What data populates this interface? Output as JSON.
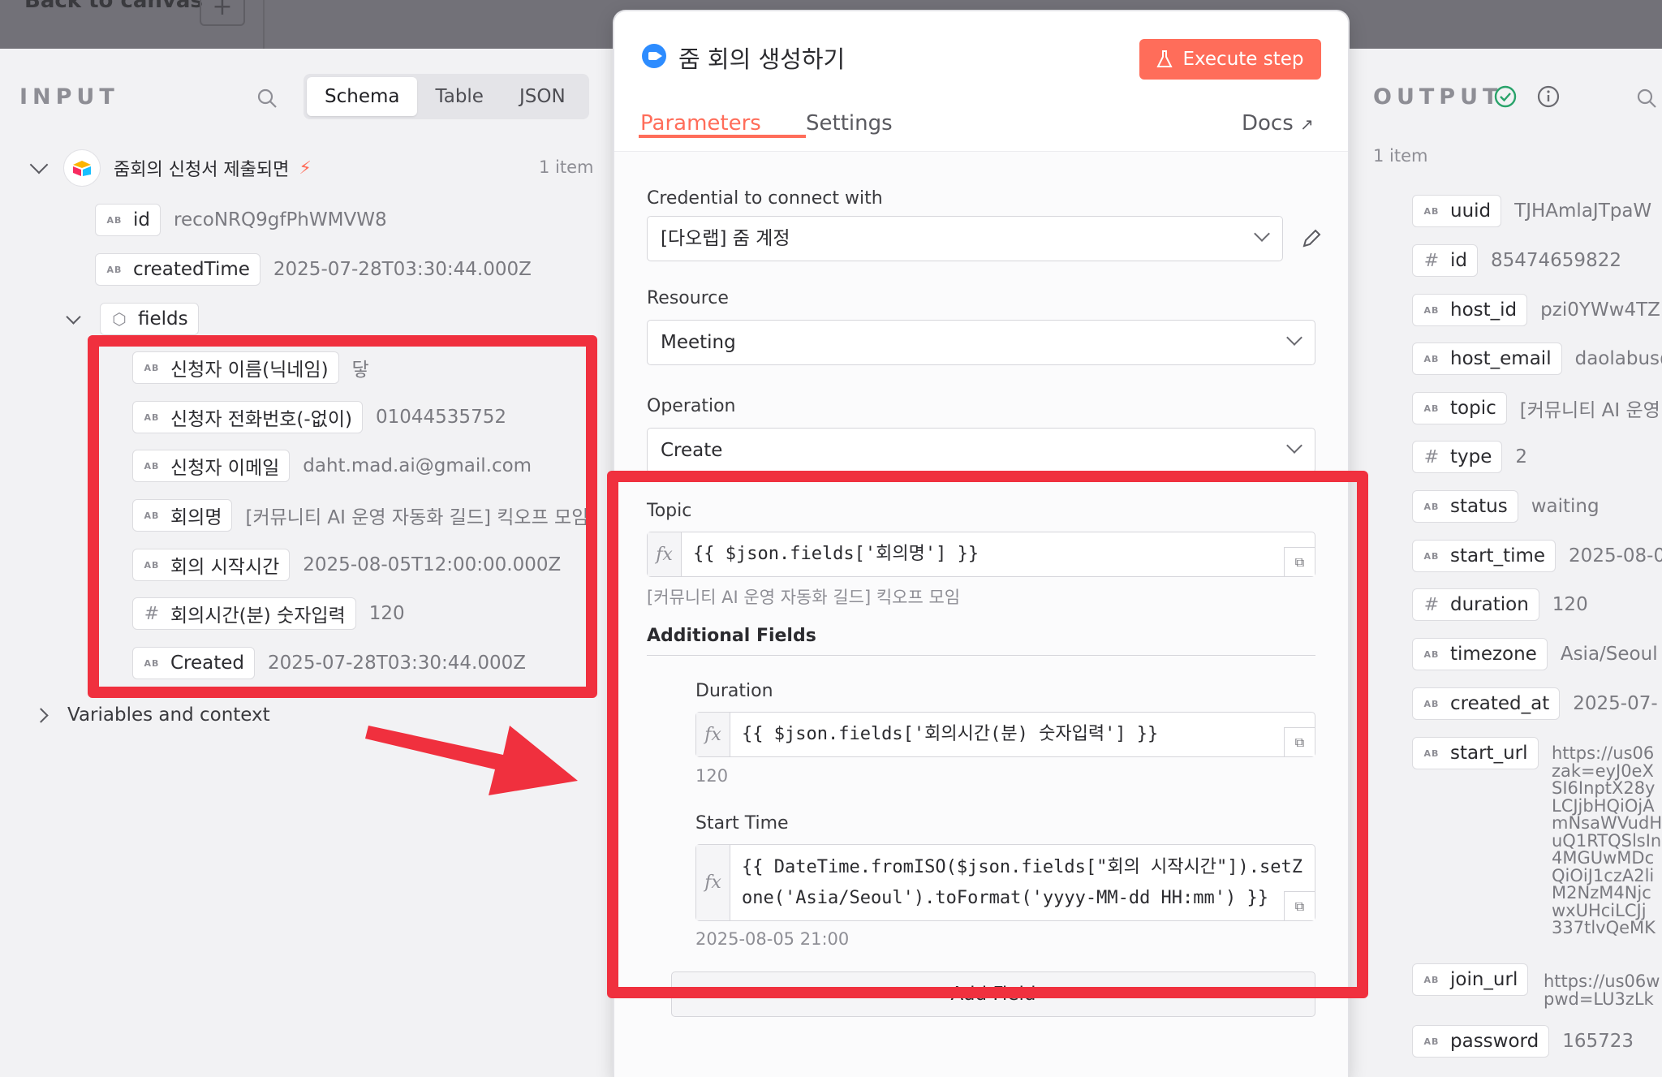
{
  "canvas": {
    "back_label": "Back to canvas",
    "plus": "+"
  },
  "input": {
    "title": "INPUT",
    "view_tabs": [
      "Schema",
      "Table",
      "JSON"
    ],
    "node_name": "줌회의 신청서 제출되면",
    "item_count": "1 item",
    "fields": [
      {
        "type": "AB",
        "key": "id",
        "value": "recoNRQ9gfPhWMVW8"
      },
      {
        "type": "AB",
        "key": "createdTime",
        "value": "2025-07-28T03:30:44.000Z"
      }
    ],
    "group_key": "fields",
    "sub_fields": [
      {
        "type": "AB",
        "key": "신청자 이름(닉네임)",
        "value": "닿"
      },
      {
        "type": "AB",
        "key": "신청자 전화번호(-없이)",
        "value": "01044535752"
      },
      {
        "type": "AB",
        "key": "신청자 이메일",
        "value": "daht.mad.ai@gmail.com"
      },
      {
        "type": "AB",
        "key": "회의명",
        "value": "[커뮤니티 AI 운영 자동화 길드] 킥오프 모임"
      },
      {
        "type": "AB",
        "key": "회의 시작시간",
        "value": "2025-08-05T12:00:00.000Z"
      },
      {
        "type": "#",
        "key": "회의시간(분) 숫자입력",
        "value": "120"
      },
      {
        "type": "AB",
        "key": "Created",
        "value": "2025-07-28T03:30:44.000Z"
      }
    ],
    "variables_label": "Variables and context"
  },
  "node": {
    "title": "줌 회의 생성하기",
    "execute_label": "Execute step",
    "tabs": {
      "parameters": "Parameters",
      "settings": "Settings",
      "docs": "Docs"
    },
    "credential_label": "Credential to connect with",
    "credential_value": "[다오랩] 줌 계정",
    "resource_label": "Resource",
    "resource_value": "Meeting",
    "operation_label": "Operation",
    "operation_value": "Create",
    "topic_label": "Topic",
    "topic_expr": "{{ $json.fields['회의명'] }}",
    "topic_result": "[커뮤니티 AI 운영 자동화 길드] 킥오프 모임",
    "additional_label": "Additional Fields",
    "duration_label": "Duration",
    "duration_expr": "{{ $json.fields['회의시간(분) 숫자입력'] }}",
    "duration_result": "120",
    "start_label": "Start Time",
    "start_expr_line1": "{{ DateTime.fromISO($json.fields[\"회의 시작시간\"]).setZ",
    "start_expr_line2": "one('Asia/Seoul').toFormat('yyyy-MM-dd HH:mm') }}",
    "start_result": "2025-08-05 21:00",
    "add_field_label": "Add Field"
  },
  "output": {
    "title": "OUTPUT",
    "item_count": "1 item",
    "fields": [
      {
        "type": "AB",
        "key": "uuid",
        "value": "TJHAmlaJTpaW"
      },
      {
        "type": "#",
        "key": "id",
        "value": "85474659822"
      },
      {
        "type": "AB",
        "key": "host_id",
        "value": "pzi0YWw4TZ"
      },
      {
        "type": "AB",
        "key": "host_email",
        "value": "daolabus@"
      },
      {
        "type": "AB",
        "key": "topic",
        "value": "[커뮤니티 AI 운영"
      },
      {
        "type": "#",
        "key": "type",
        "value": "2"
      },
      {
        "type": "AB",
        "key": "status",
        "value": "waiting"
      },
      {
        "type": "AB",
        "key": "start_time",
        "value": "2025-08-0"
      },
      {
        "type": "#",
        "key": "duration",
        "value": "120"
      },
      {
        "type": "AB",
        "key": "timezone",
        "value": "Asia/Seoul"
      },
      {
        "type": "AB",
        "key": "created_at",
        "value": "2025-07-"
      }
    ],
    "start_url_key": "start_url",
    "start_url_lines": [
      "https://us06",
      "zak=eyJ0eX",
      "SI6InptX28y",
      "LCJjbHQiOjA",
      "mNsaWVudH",
      "uQ1RTQSlsIn",
      "4MGUwMDc",
      "QiOiJ1czA2li",
      "M2NzM4Njc",
      "wxUHciLCJj",
      "337tlvQeMK"
    ],
    "join_url_key": "join_url",
    "join_url_lines": [
      "https://us06w",
      "pwd=LU3zLk"
    ],
    "password_key": "password",
    "password_value": "165723"
  },
  "colors": {
    "accent": "#ff6d5a",
    "annotation_red": "#f0303e",
    "success": "#29a36a"
  }
}
